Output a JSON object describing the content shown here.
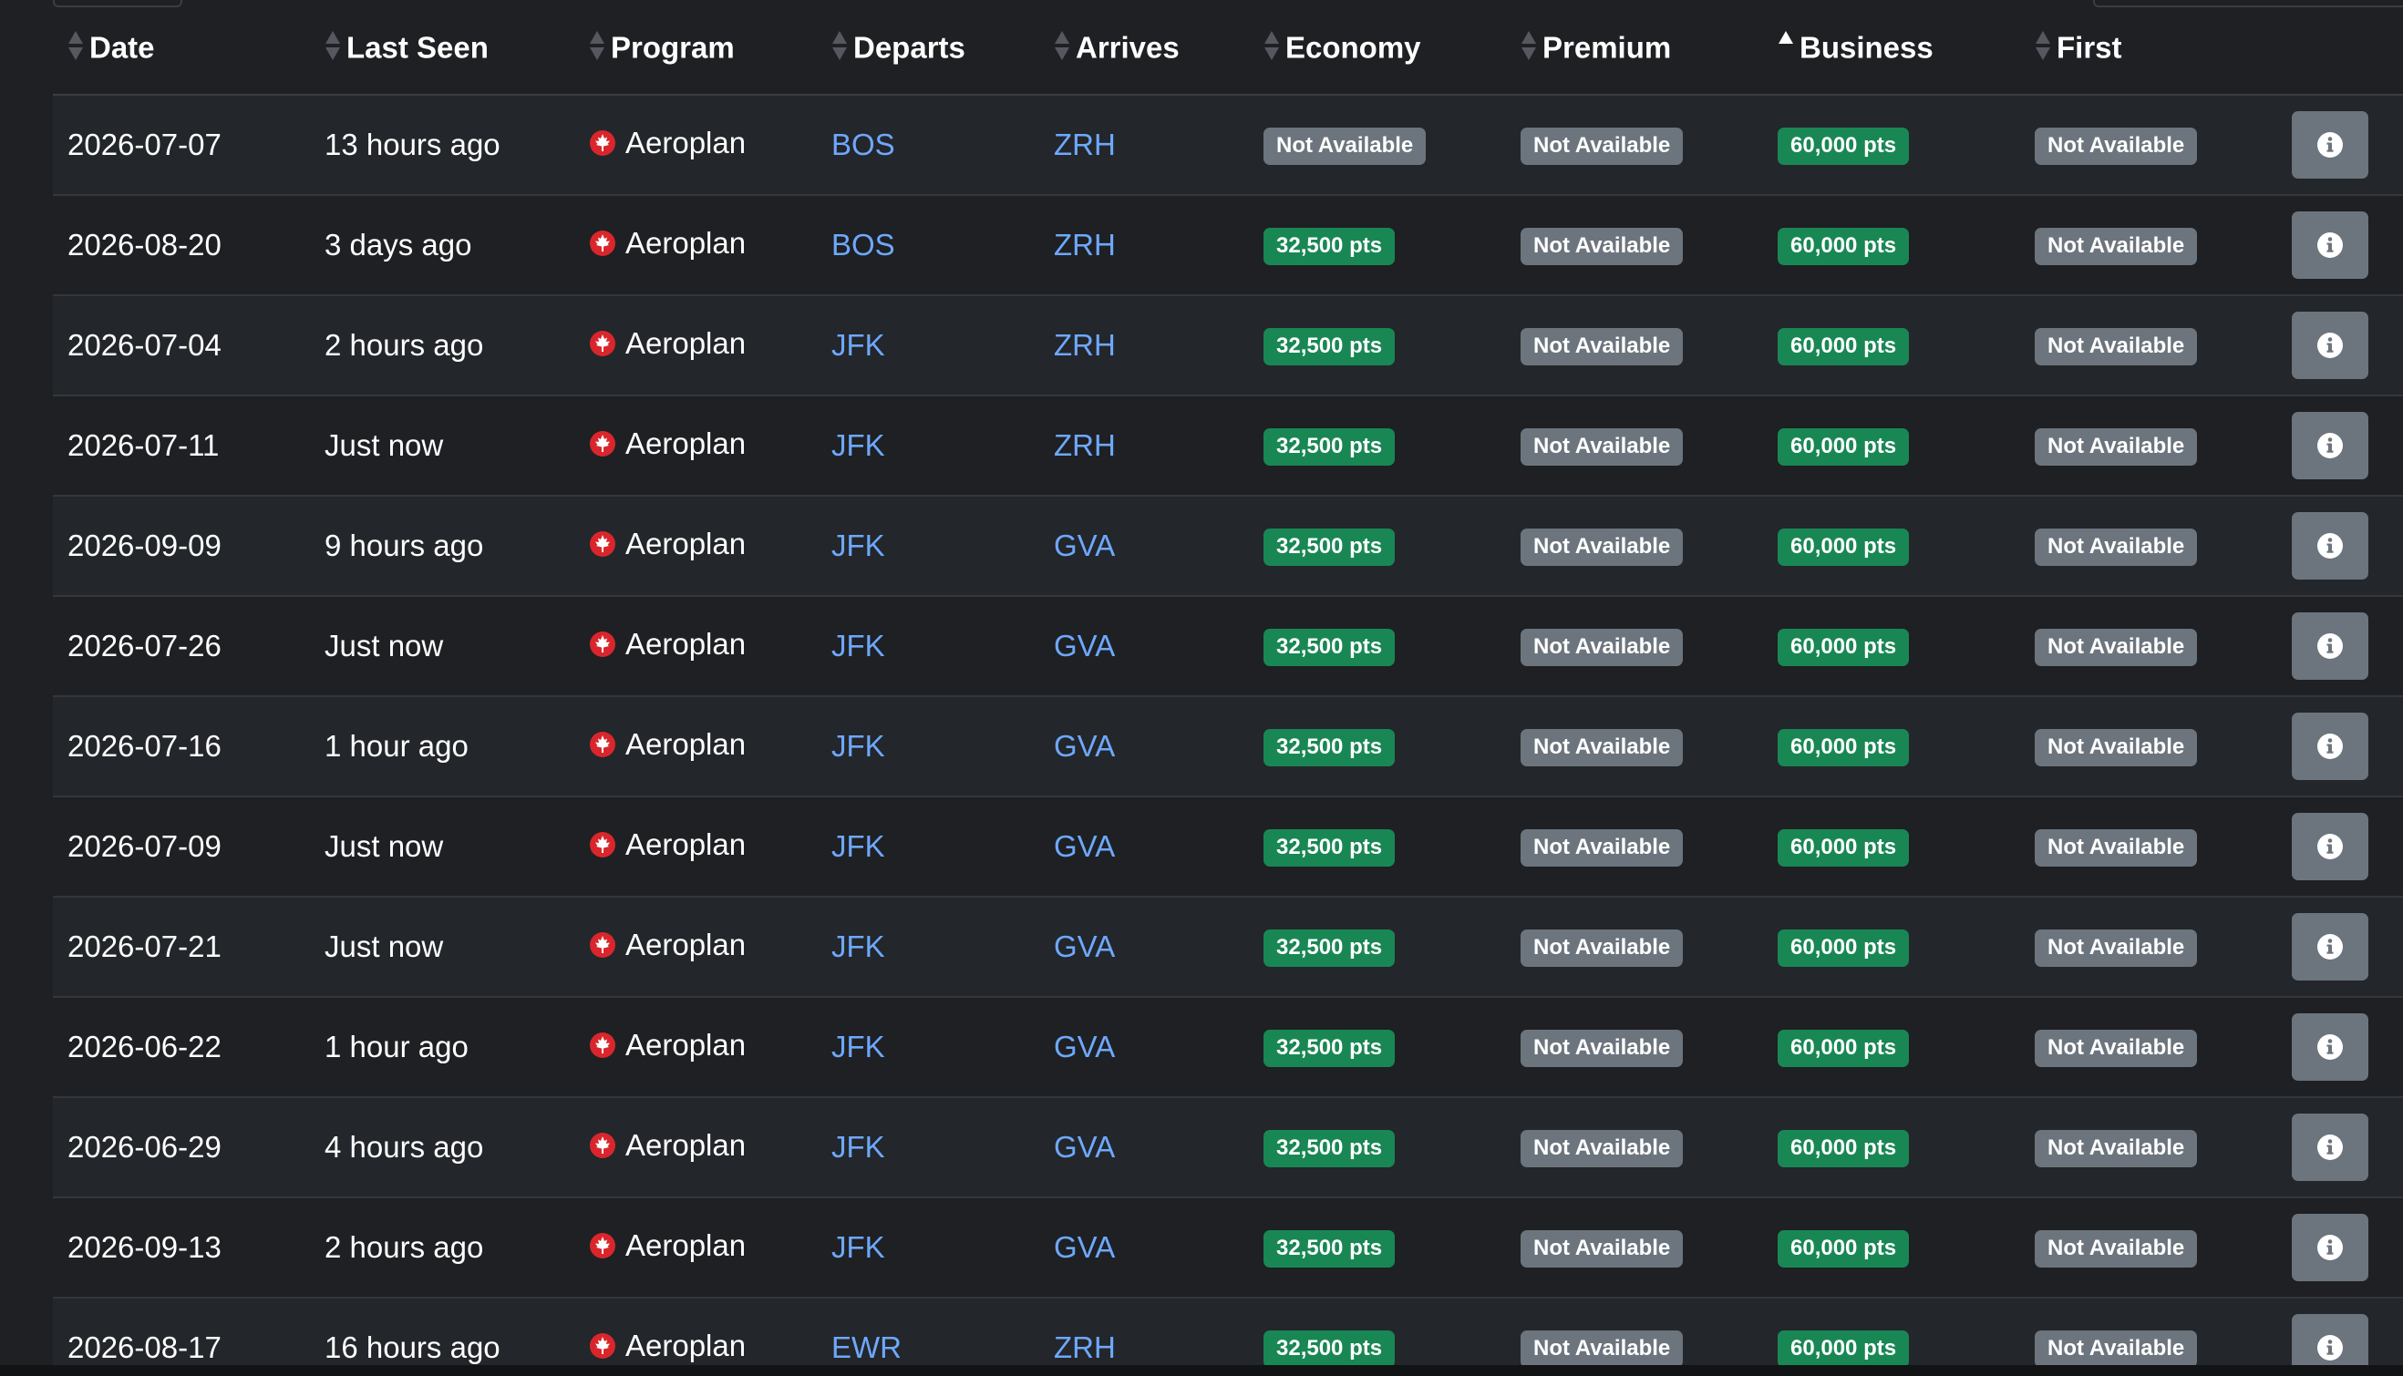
{
  "columns": {
    "date": "Date",
    "last_seen": "Last Seen",
    "program": "Program",
    "departs": "Departs",
    "arrives": "Arrives",
    "economy": "Economy",
    "premium": "Premium",
    "business": "Business",
    "first": "First"
  },
  "icons": {
    "sort": "sort-both-icon",
    "sort_active": "sort-ascending-icon",
    "program": "maple-leaf-icon",
    "info": "info-icon"
  },
  "colors": {
    "available": "#198754",
    "not_available": "#6c757d",
    "airport_link": "#6ea8fe",
    "program_icon": "#d9262c"
  },
  "rows": [
    {
      "date": "2026-07-07",
      "last_seen": "13 hours ago",
      "program": "Aeroplan",
      "departs": "BOS",
      "arrives": "ZRH",
      "economy": "Not Available",
      "economy_status": "na",
      "premium": "Not Available",
      "premium_status": "na",
      "business": "60,000 pts",
      "business_status": "avail",
      "first": "Not Available",
      "first_status": "na"
    },
    {
      "date": "2026-08-20",
      "last_seen": "3 days ago",
      "program": "Aeroplan",
      "departs": "BOS",
      "arrives": "ZRH",
      "economy": "32,500 pts",
      "economy_status": "avail",
      "premium": "Not Available",
      "premium_status": "na",
      "business": "60,000 pts",
      "business_status": "avail",
      "first": "Not Available",
      "first_status": "na"
    },
    {
      "date": "2026-07-04",
      "last_seen": "2 hours ago",
      "program": "Aeroplan",
      "departs": "JFK",
      "arrives": "ZRH",
      "economy": "32,500 pts",
      "economy_status": "avail",
      "premium": "Not Available",
      "premium_status": "na",
      "business": "60,000 pts",
      "business_status": "avail",
      "first": "Not Available",
      "first_status": "na"
    },
    {
      "date": "2026-07-11",
      "last_seen": "Just now",
      "program": "Aeroplan",
      "departs": "JFK",
      "arrives": "ZRH",
      "economy": "32,500 pts",
      "economy_status": "avail",
      "premium": "Not Available",
      "premium_status": "na",
      "business": "60,000 pts",
      "business_status": "avail",
      "first": "Not Available",
      "first_status": "na"
    },
    {
      "date": "2026-09-09",
      "last_seen": "9 hours ago",
      "program": "Aeroplan",
      "departs": "JFK",
      "arrives": "GVA",
      "economy": "32,500 pts",
      "economy_status": "avail",
      "premium": "Not Available",
      "premium_status": "na",
      "business": "60,000 pts",
      "business_status": "avail",
      "first": "Not Available",
      "first_status": "na"
    },
    {
      "date": "2026-07-26",
      "last_seen": "Just now",
      "program": "Aeroplan",
      "departs": "JFK",
      "arrives": "GVA",
      "economy": "32,500 pts",
      "economy_status": "avail",
      "premium": "Not Available",
      "premium_status": "na",
      "business": "60,000 pts",
      "business_status": "avail",
      "first": "Not Available",
      "first_status": "na"
    },
    {
      "date": "2026-07-16",
      "last_seen": "1 hour ago",
      "program": "Aeroplan",
      "departs": "JFK",
      "arrives": "GVA",
      "economy": "32,500 pts",
      "economy_status": "avail",
      "premium": "Not Available",
      "premium_status": "na",
      "business": "60,000 pts",
      "business_status": "avail",
      "first": "Not Available",
      "first_status": "na"
    },
    {
      "date": "2026-07-09",
      "last_seen": "Just now",
      "program": "Aeroplan",
      "departs": "JFK",
      "arrives": "GVA",
      "economy": "32,500 pts",
      "economy_status": "avail",
      "premium": "Not Available",
      "premium_status": "na",
      "business": "60,000 pts",
      "business_status": "avail",
      "first": "Not Available",
      "first_status": "na"
    },
    {
      "date": "2026-07-21",
      "last_seen": "Just now",
      "program": "Aeroplan",
      "departs": "JFK",
      "arrives": "GVA",
      "economy": "32,500 pts",
      "economy_status": "avail",
      "premium": "Not Available",
      "premium_status": "na",
      "business": "60,000 pts",
      "business_status": "avail",
      "first": "Not Available",
      "first_status": "na"
    },
    {
      "date": "2026-06-22",
      "last_seen": "1 hour ago",
      "program": "Aeroplan",
      "departs": "JFK",
      "arrives": "GVA",
      "economy": "32,500 pts",
      "economy_status": "avail",
      "premium": "Not Available",
      "premium_status": "na",
      "business": "60,000 pts",
      "business_status": "avail",
      "first": "Not Available",
      "first_status": "na"
    },
    {
      "date": "2026-06-29",
      "last_seen": "4 hours ago",
      "program": "Aeroplan",
      "departs": "JFK",
      "arrives": "GVA",
      "economy": "32,500 pts",
      "economy_status": "avail",
      "premium": "Not Available",
      "premium_status": "na",
      "business": "60,000 pts",
      "business_status": "avail",
      "first": "Not Available",
      "first_status": "na"
    },
    {
      "date": "2026-09-13",
      "last_seen": "2 hours ago",
      "program": "Aeroplan",
      "departs": "JFK",
      "arrives": "GVA",
      "economy": "32,500 pts",
      "economy_status": "avail",
      "premium": "Not Available",
      "premium_status": "na",
      "business": "60,000 pts",
      "business_status": "avail",
      "first": "Not Available",
      "first_status": "na"
    },
    {
      "date": "2026-08-17",
      "last_seen": "16 hours ago",
      "program": "Aeroplan",
      "departs": "EWR",
      "arrives": "ZRH",
      "economy": "32,500 pts",
      "economy_status": "avail",
      "premium": "Not Available",
      "premium_status": "na",
      "business": "60,000 pts",
      "business_status": "avail",
      "first": "Not Available",
      "first_status": "na"
    }
  ]
}
